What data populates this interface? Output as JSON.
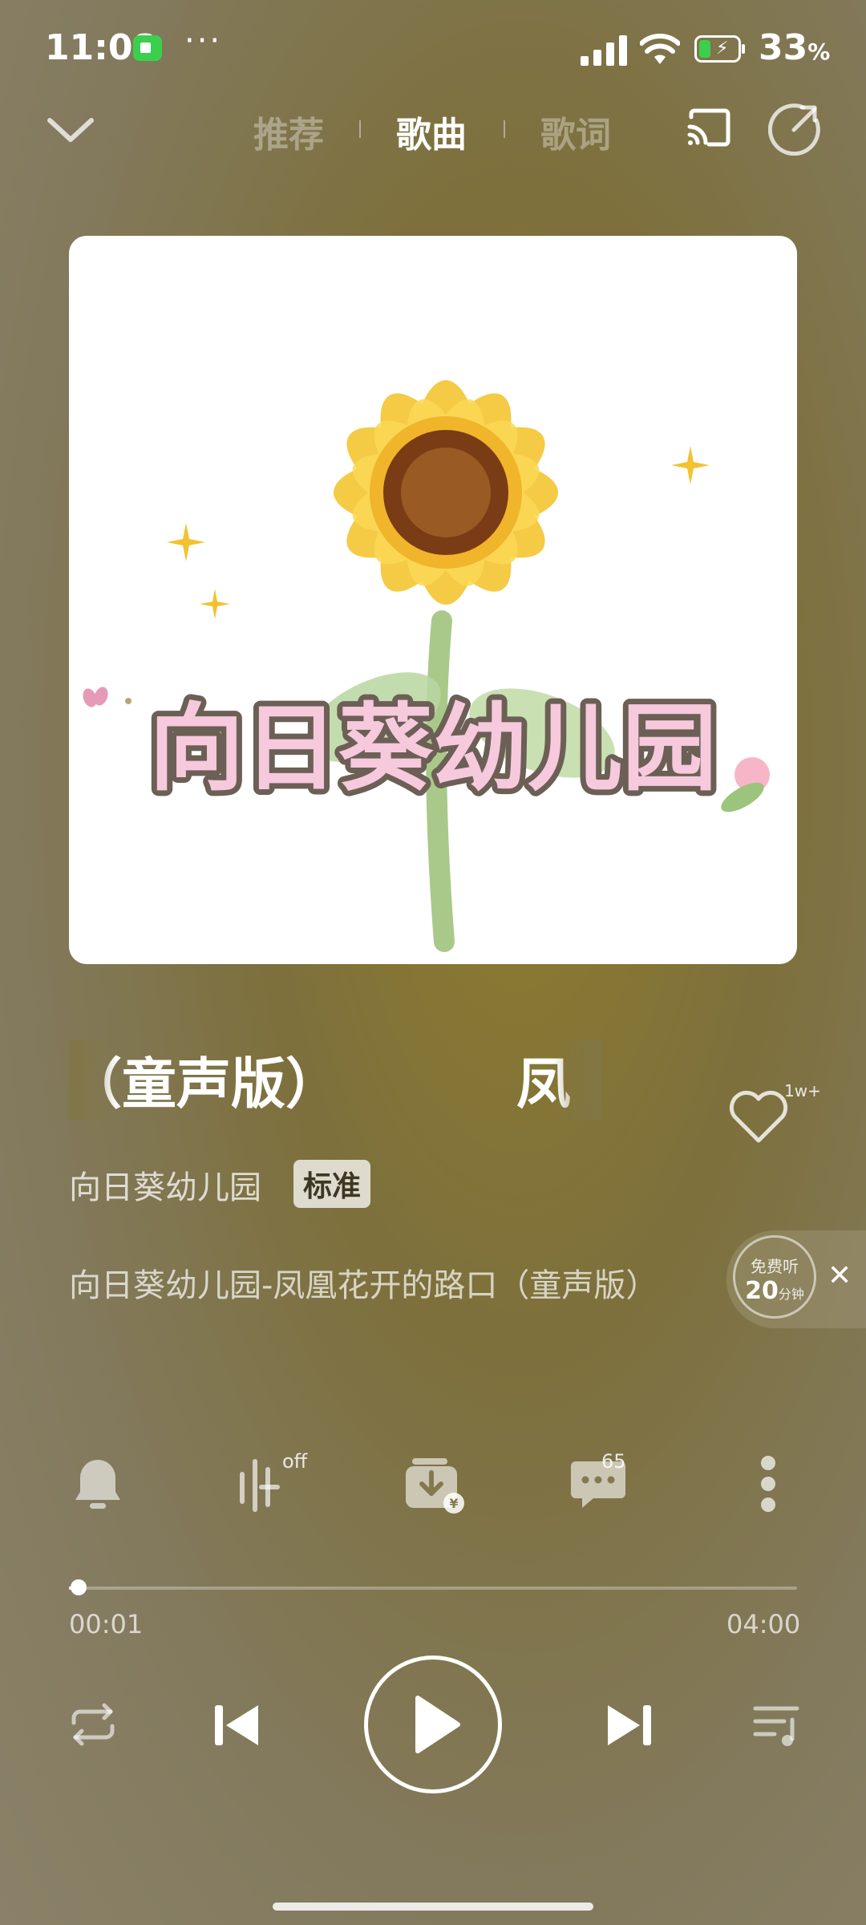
{
  "status_bar": {
    "time": "11:08",
    "dots": "···",
    "battery_percent": "33",
    "battery_unit": "%"
  },
  "nav": {
    "tabs": [
      {
        "label": "推荐",
        "active": false
      },
      {
        "label": "歌曲",
        "active": true
      },
      {
        "label": "歌词",
        "active": false
      }
    ]
  },
  "album": {
    "art_text": "向日葵幼儿园"
  },
  "song": {
    "title_scroll": "口（童声版）",
    "title_scroll_next": "凤",
    "artist": "向日葵幼儿园",
    "quality": "标准",
    "subtitle": "向日葵幼儿园-凤凰花开的路口（童声版）",
    "like_count": "1w+"
  },
  "free_listen": {
    "label": "免费听",
    "minutes": "20",
    "unit": "分钟",
    "close": "✕"
  },
  "actions": {
    "eq_state": "off",
    "comment_count": "65"
  },
  "progress": {
    "current": "00:01",
    "total": "04:00",
    "fraction": 0.004
  },
  "colors": {
    "accent": "#ffffff",
    "background": "#837a4e",
    "battery_green": "#3ccf4e"
  }
}
